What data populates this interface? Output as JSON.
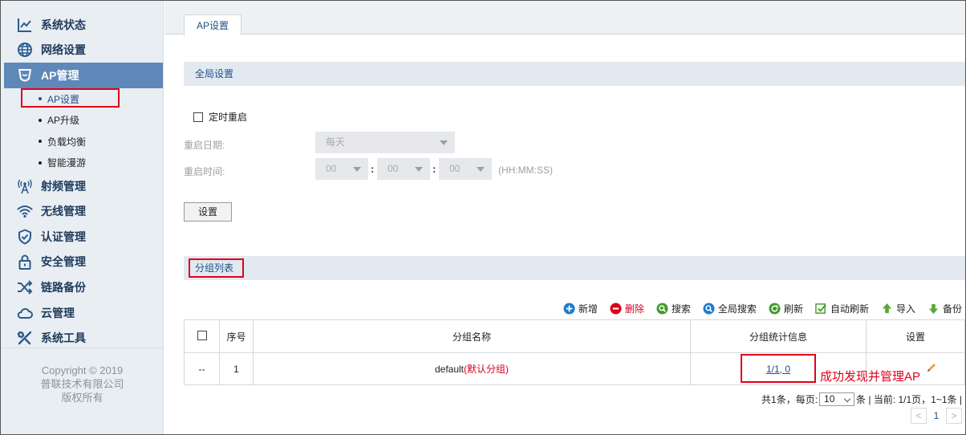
{
  "sidebar": {
    "items": [
      {
        "label": "系统状态",
        "icon": "chart-line-icon"
      },
      {
        "label": "网络设置",
        "icon": "globe-icon"
      },
      {
        "label": "AP管理",
        "icon": "ap-shield-icon",
        "active": true
      },
      {
        "label": "射频管理",
        "icon": "antenna-icon"
      },
      {
        "label": "无线管理",
        "icon": "wifi-icon"
      },
      {
        "label": "认证管理",
        "icon": "shield-check-icon"
      },
      {
        "label": "安全管理",
        "icon": "lock-icon"
      },
      {
        "label": "链路备份",
        "icon": "shuffle-icon"
      },
      {
        "label": "云管理",
        "icon": "cloud-icon"
      },
      {
        "label": "系统工具",
        "icon": "tools-icon"
      }
    ],
    "ap_sub_items": [
      {
        "label": "AP设置",
        "selected": true
      },
      {
        "label": "AP升级"
      },
      {
        "label": "负载均衡"
      },
      {
        "label": "智能漫游"
      }
    ],
    "copyright": [
      "Copyright © 2019",
      "普联技术有限公司",
      "版权所有"
    ]
  },
  "tabs": [
    "AP设置"
  ],
  "global": {
    "section_title": "全局设置",
    "timed_reboot_label": "定时重启",
    "reboot_date_label": "重启日期:",
    "reboot_date_value": "每天",
    "reboot_time_label": "重启时间:",
    "hour": "00",
    "minute": "00",
    "second": "00",
    "time_format_hint": "(HH:MM:SS)",
    "set_button": "设置"
  },
  "group": {
    "section_title": "分组列表",
    "toolbar": [
      {
        "label": "新增",
        "icon": "add-circle-icon",
        "color": "#1f7ad1"
      },
      {
        "label": "删除",
        "icon": "delete-circle-icon",
        "color": "#d6001c"
      },
      {
        "label": "搜索",
        "icon": "search-icon",
        "color": "#3f9a2a"
      },
      {
        "label": "全局搜索",
        "icon": "global-search-icon",
        "color": "#1f7ad1"
      },
      {
        "label": "刷新",
        "icon": "refresh-icon",
        "color": "#3f9a2a"
      },
      {
        "label": "自动刷新",
        "icon": "auto-refresh-icon",
        "color": "#3f9a2a"
      },
      {
        "label": "导入",
        "icon": "import-icon",
        "color": "#5aa83a"
      },
      {
        "label": "备份",
        "icon": "backup-icon",
        "color": "#5aa83a"
      }
    ],
    "columns": [
      "",
      "序号",
      "分组名称",
      "分组统计信息",
      "设置"
    ],
    "rows": [
      {
        "check": "--",
        "index": "1",
        "name": "default",
        "name_tag": "(默认分组)",
        "stats": "1/1, 0"
      }
    ],
    "annotation": "成功发现并管理AP",
    "pager": {
      "total_prefix": "共1条，每页:",
      "per_page": "10",
      "suffix": "条 | 当前: 1/1页，1~1条 |",
      "current_page": "1",
      "prev": "<",
      "next": ">"
    }
  }
}
